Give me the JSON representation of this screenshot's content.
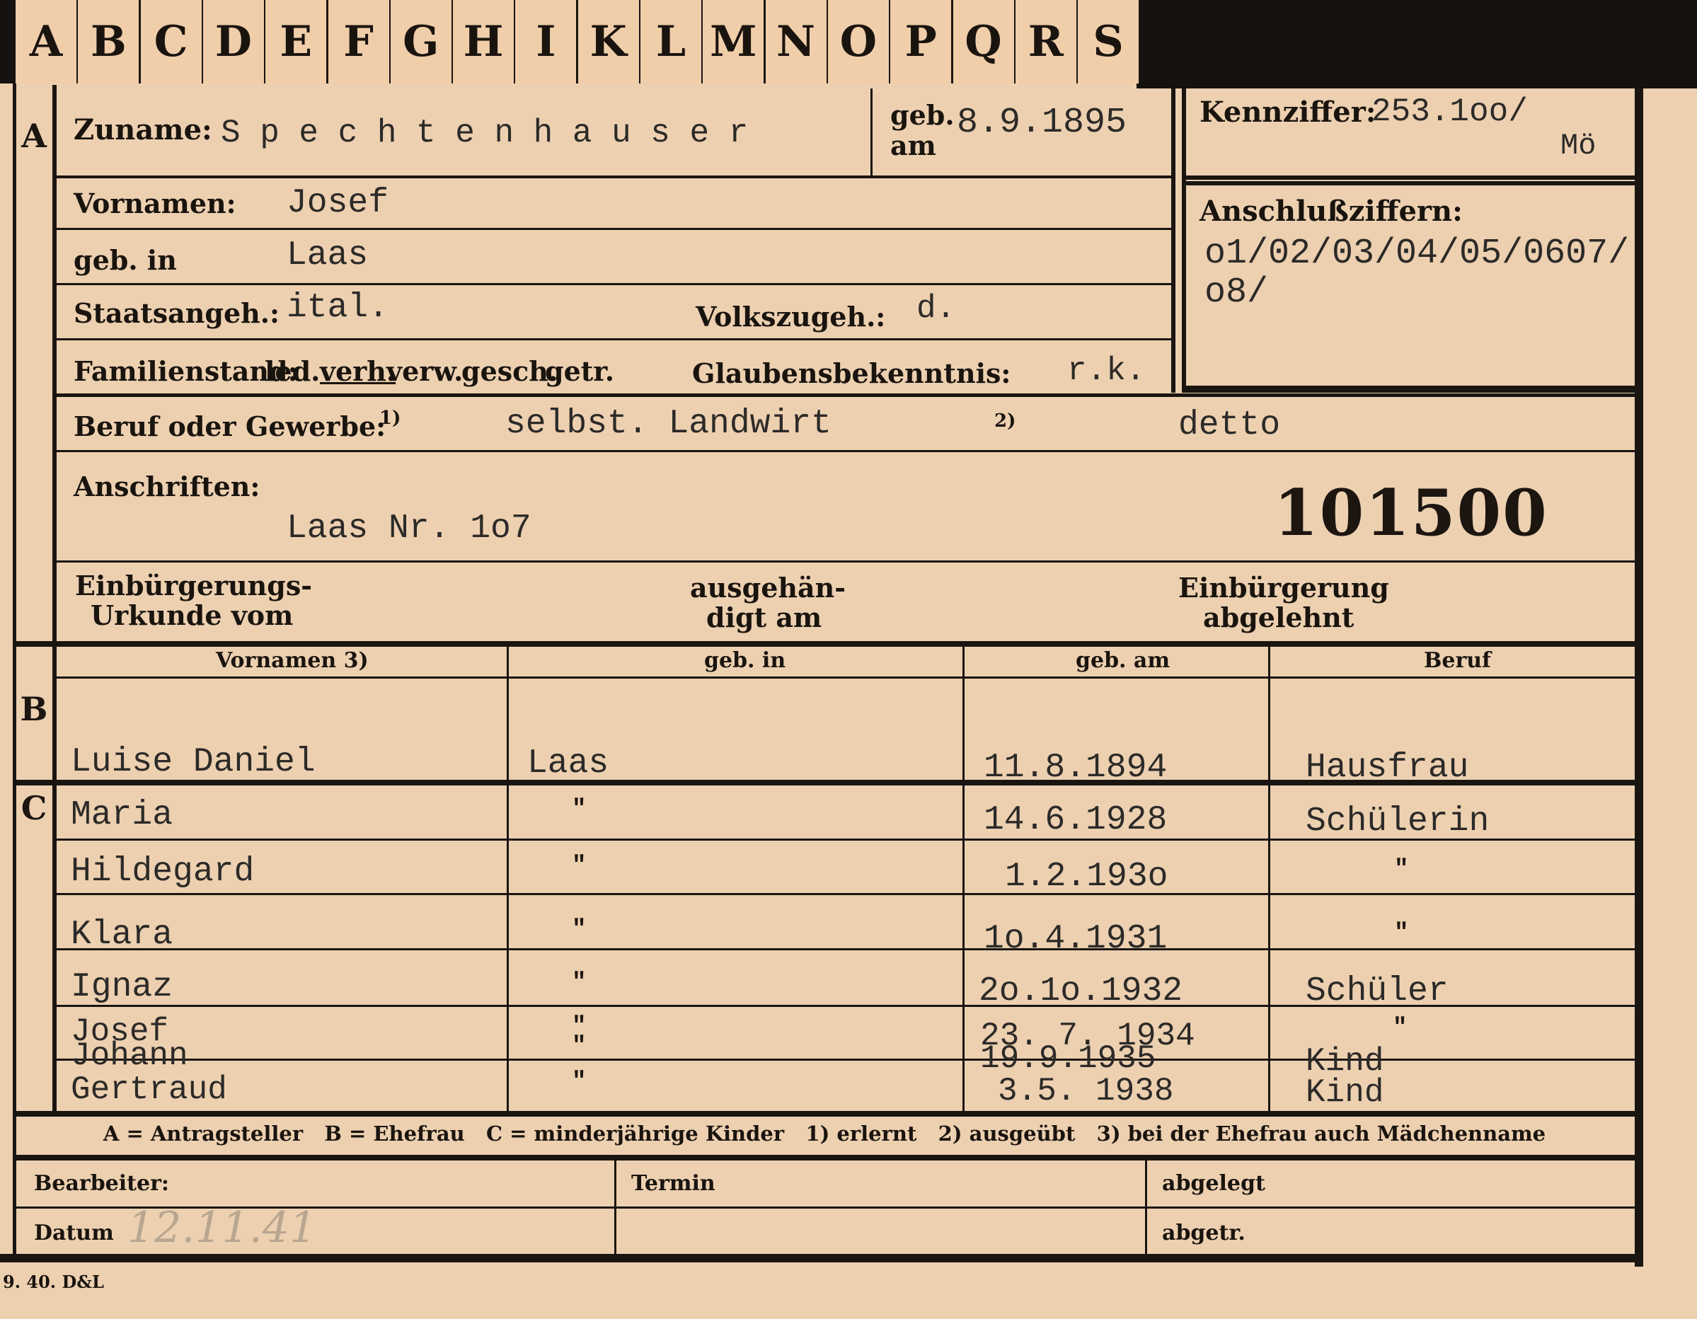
{
  "tabs": [
    "A",
    "B",
    "C",
    "D",
    "E",
    "F",
    "G",
    "H",
    "I",
    "K",
    "L",
    "M",
    "N",
    "O",
    "P",
    "Q",
    "R",
    "S"
  ],
  "section_letters": {
    "a": "A",
    "b": "B",
    "c": "C"
  },
  "applicant": {
    "surname_label": "Zuname:",
    "surname": "S p e c h t e n h a u s e r",
    "born_on_label_1": "geb.",
    "born_on_label_2": "am",
    "born_on": "8.9.1895",
    "given_label": "Vornamen:",
    "given": "Josef",
    "born_in_label": "geb. in",
    "born_in": "Laas",
    "citizenship_label": "Staatsangeh.:",
    "citizenship": "ital.",
    "ethnicity_label": "Volkszugeh.:",
    "ethnicity": "d.",
    "marital_label": "Familienstand:",
    "marital_options": [
      "led.",
      "verh.",
      "verw.",
      "gesch.",
      "getr."
    ],
    "religion_label": "Glaubensbekenntnis:",
    "religion": "r.k.",
    "occupation_label": "Beruf oder Gewerbe:",
    "occ_note1": "1)",
    "occupation_learned": "selbst. Landwirt",
    "occ_note2": "2)",
    "occupation_practiced": "detto",
    "address_label": "Anschriften:",
    "address": "Laas Nr. 1o7",
    "stamp_number": "101500",
    "naturalization_label_1": "Einbürgerungs-",
    "naturalization_label_2": "Urkunde vom",
    "handed_label_1": "ausgehän-",
    "handed_label_2": "digt am",
    "rejected_label_1": "Einbürgerung",
    "rejected_label_2": "abgelehnt"
  },
  "reference": {
    "label": "Kennziffer:",
    "value": "253.1oo/",
    "suffix": "Mö",
    "link_label": "Anschlußziffern:",
    "link_line1": "o1/02/03/04/05/0607/",
    "link_line2": "o8/"
  },
  "family_table": {
    "headers": [
      "Vornamen 3)",
      "geb. in",
      "geb. am",
      "Beruf"
    ],
    "wife": {
      "name": "Luise Daniel",
      "place": "Laas",
      "date": "11.8.1894",
      "job": "Hausfrau"
    },
    "children": [
      {
        "name": "Maria",
        "place": "\"",
        "date": "14.6.1928",
        "job": "Schülerin"
      },
      {
        "name": "Hildegard",
        "place": "\"",
        "date": "1.2.193o",
        "job": "\""
      },
      {
        "name": "Klara",
        "place": "\"",
        "date": "1o.4.1931",
        "job": "\""
      },
      {
        "name": "Ignaz",
        "place": "\"",
        "date": "2o.1o.1932",
        "job": "Schüler"
      },
      {
        "name": "Josef",
        "place": "\"",
        "date": "23. 7. 1934",
        "job": "\""
      },
      {
        "name": "Johann",
        "place": "\"",
        "date": "19.9.1935",
        "job": "Kind"
      },
      {
        "name": "Gertraud",
        "place": "\"",
        "date": "3.5. 1938",
        "job": "Kind"
      }
    ]
  },
  "legend": "A = Antragsteller   B = Ehefrau   C = minderjährige Kinder   1) erlernt   2) ausgeübt   3) bei der Ehefrau auch Mädchenname",
  "footer": {
    "processor_label": "Bearbeiter:",
    "date_label": "Datum",
    "date_value": "12.11.41",
    "deadline_label": "Termin",
    "filed_label": "abgelegt",
    "removed_label": "abgetr."
  },
  "form_code": "9. 40. D&L"
}
